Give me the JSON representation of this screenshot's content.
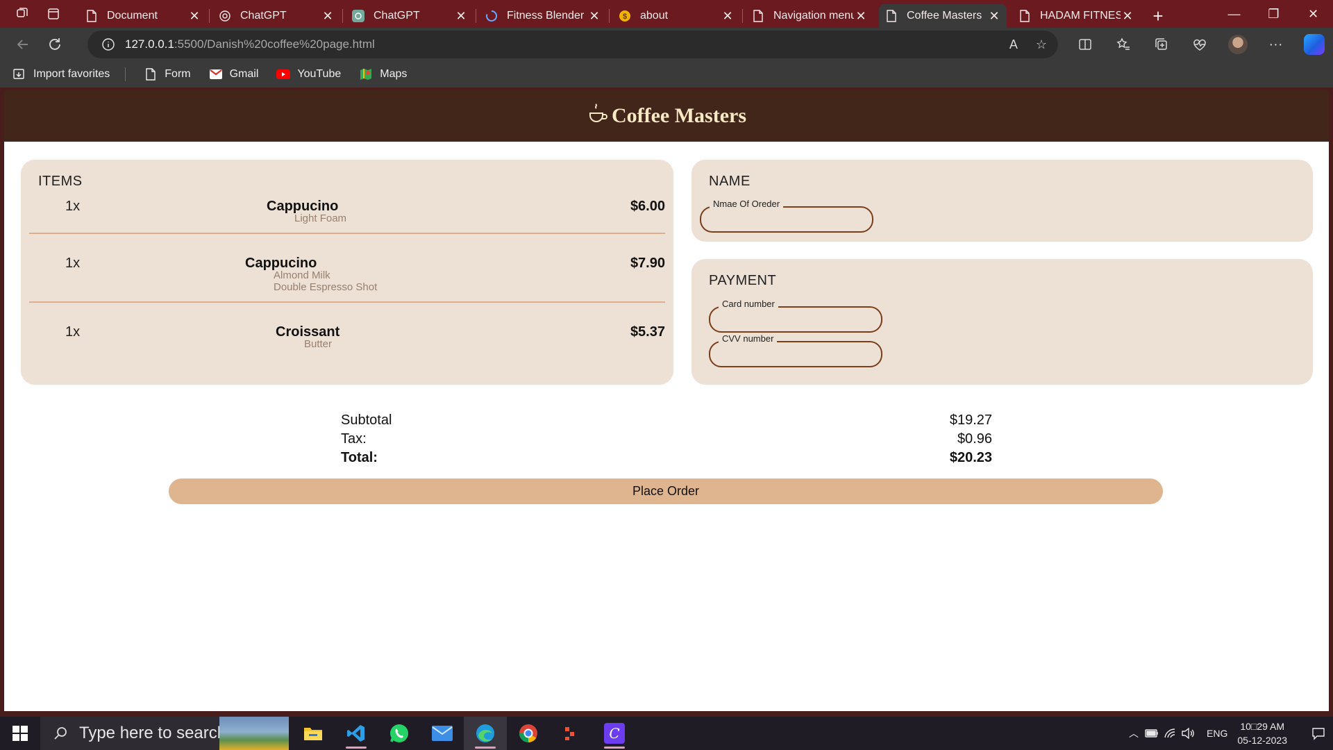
{
  "browser": {
    "tabs": [
      {
        "title": "Document",
        "icon": "page-icon"
      },
      {
        "title": "ChatGPT",
        "icon": "chatgpt-icon"
      },
      {
        "title": "ChatGPT",
        "icon": "chatgpt-icon"
      },
      {
        "title": "Fitness Blender",
        "icon": "loading-icon"
      },
      {
        "title": "about",
        "icon": "coin-icon"
      },
      {
        "title": "Navigation menu",
        "icon": "page-icon"
      },
      {
        "title": "Coffee Masters",
        "icon": "page-icon",
        "active": true
      },
      {
        "title": "HADAM FITNESS",
        "icon": "page-icon"
      }
    ],
    "url_host": "127.0.0.1",
    "url_path": ":5500/Danish%20coffee%20page.html",
    "read_aloud": "A",
    "favorites": [
      {
        "label": "Import favorites",
        "icon": "import-icon"
      },
      {
        "label": "Form",
        "icon": "page-icon"
      },
      {
        "label": "Gmail",
        "icon": "gmail-icon"
      },
      {
        "label": "YouTube",
        "icon": "youtube-icon"
      },
      {
        "label": "Maps",
        "icon": "maps-icon"
      }
    ],
    "colors": {
      "tabstrip": "#6b1a1f",
      "toolbar": "#3a3a3a"
    }
  },
  "page": {
    "site_title": "Coffee Masters",
    "items_heading": "ITEMS",
    "items": [
      {
        "qty": "1x",
        "name": "Cappucino",
        "modifiers": [
          "Light Foam"
        ],
        "price": "$6.00"
      },
      {
        "qty": "1x",
        "name": "Cappucino",
        "modifiers": [
          "Almond Milk",
          "Double Espresso Shot"
        ],
        "price": "$7.90"
      },
      {
        "qty": "1x",
        "name": "Croissant",
        "modifiers": [
          "Butter"
        ],
        "price": "$5.37"
      }
    ],
    "name_heading": "NAME",
    "name_field_label": "Nmae Of Oreder",
    "name_field_value": "",
    "payment_heading": "PAYMENT",
    "card_field_label": "Card number",
    "card_field_value": "",
    "cvv_field_label": "CVV number",
    "cvv_field_value": "",
    "totals": {
      "subtotal_label": "Subtotal",
      "subtotal": "$19.27",
      "tax_label": "Tax:",
      "tax": "$0.96",
      "total_label": "Total:",
      "total": "$20.23"
    },
    "place_order_label": "Place Order",
    "colors": {
      "header_bg": "#43261a",
      "header_text": "#f7e8c6",
      "card_bg": "#ede0d5",
      "divider": "#dcb08e",
      "field_border": "#7a3e1a",
      "button_bg": "#dfb590"
    }
  },
  "taskbar": {
    "search_placeholder": "Type here to search",
    "apps": [
      "file-explorer-icon",
      "vscode-icon",
      "whatsapp-icon",
      "mail-icon",
      "edge-icon",
      "chrome-icon",
      "git-icon",
      "canva-icon"
    ],
    "language": "ENG",
    "time": "10□29 AM",
    "date": "05-12-2023"
  }
}
